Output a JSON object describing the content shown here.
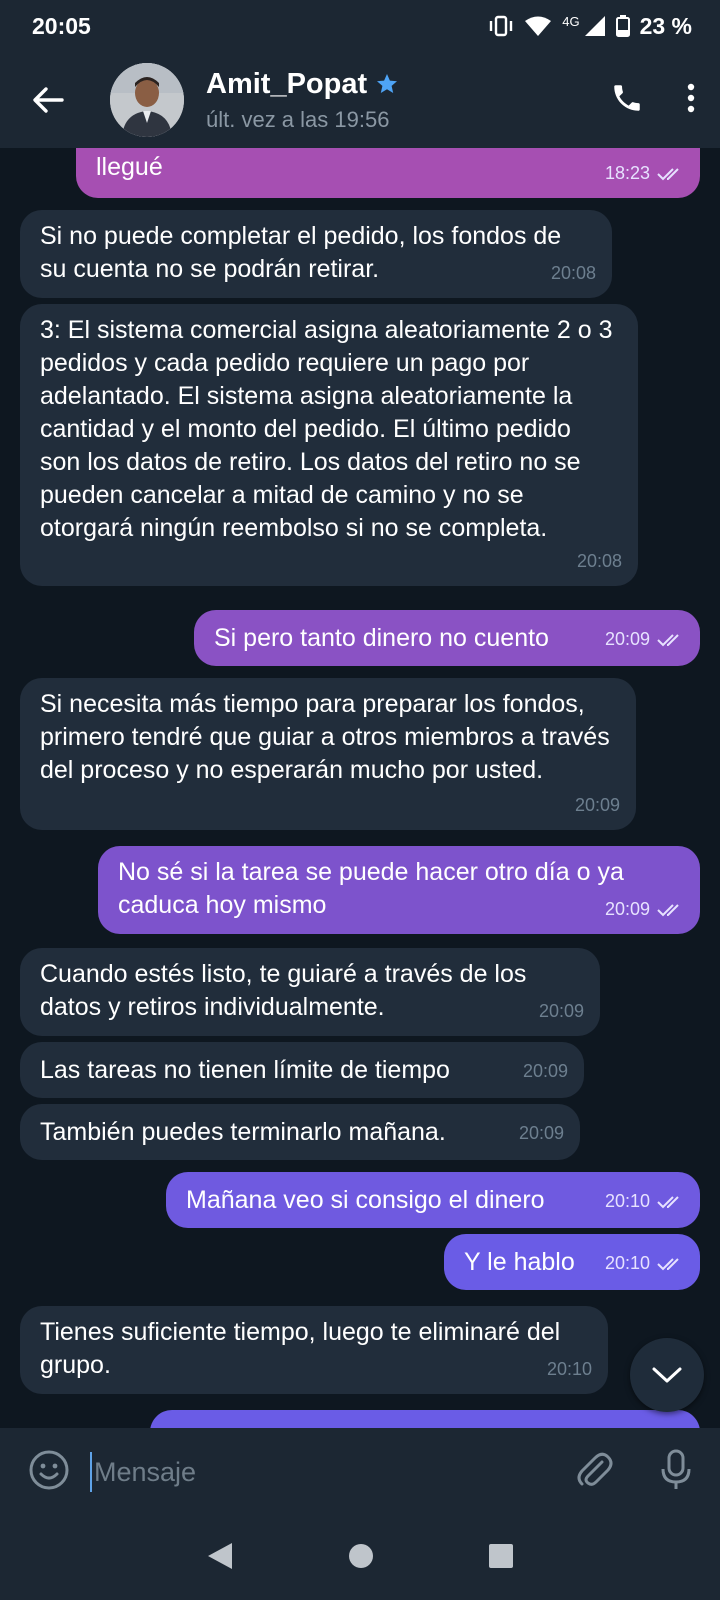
{
  "status_bar": {
    "time": "20:05",
    "network": "4G",
    "battery": "23 %"
  },
  "header": {
    "contact_name": "Amit_Popat",
    "contact_status": "últ. vez a las 19:56"
  },
  "messages": [
    {
      "dir": "out",
      "text": "Bien dios en el grupo era de roceso y hasta ahí llegué",
      "time": "18:23",
      "checks": true
    },
    {
      "dir": "in",
      "text": "Si no puede completar el pedido, los fondos de su cuenta no se podrán retirar.",
      "time": "20:08"
    },
    {
      "dir": "in",
      "text": "3: El sistema comercial asigna aleatoriamente 2 o 3 pedidos y cada pedido requiere un pago por adelantado. El sistema asigna aleatoriamente la cantidad y el monto del pedido. El último pedido son los datos de retiro. Los datos del retiro no se pueden cancelar a mitad de camino y no se otorgará ningún reembolso si no se completa.",
      "time": "20:08"
    },
    {
      "dir": "out",
      "text": "Si pero tanto dinero no cuento",
      "time": "20:09",
      "checks": true
    },
    {
      "dir": "in",
      "text": "Si necesita más tiempo para preparar los fondos, primero tendré que guiar a otros miembros a través del proceso y no esperarán mucho por usted.",
      "time": "20:09"
    },
    {
      "dir": "out",
      "text": "No sé si la tarea se puede hacer otro día o ya caduca hoy mismo",
      "time": "20:09",
      "checks": true
    },
    {
      "dir": "in",
      "text": "Cuando estés listo, te guiaré a través de los datos y retiros individualmente.",
      "time": "20:09"
    },
    {
      "dir": "in",
      "text": "Las tareas no tienen límite de tiempo",
      "time": "20:09"
    },
    {
      "dir": "in",
      "text": "También puedes terminarlo mañana.",
      "time": "20:09"
    },
    {
      "dir": "out",
      "text": "Mañana veo si consigo el dinero",
      "time": "20:10",
      "checks": true
    },
    {
      "dir": "out",
      "text": "Y le hablo",
      "time": "20:10",
      "checks": true
    },
    {
      "dir": "in",
      "text": "Tienes suficiente tiempo, luego te eliminaré del grupo.",
      "time": "20:10"
    }
  ],
  "input": {
    "placeholder": "Mensaje"
  },
  "colors": {
    "header_bg": "#1c2733",
    "chat_bg": "#0e1720",
    "incoming_bubble": "#212d3b",
    "outgoing_top": "#a84fb3",
    "outgoing_bottom": "#6a5ce6",
    "verified_star": "#4ea4f6",
    "caret": "#5fa3e8"
  },
  "icons": {
    "back": "arrow-left-icon",
    "verified": "star-icon",
    "call": "phone-icon",
    "menu": "more-vertical-icon",
    "emoji": "smiley-icon",
    "attach": "paperclip-icon",
    "voice": "microphone-icon",
    "scroll": "chevron-down-icon",
    "nav_back": "triangle-back-icon",
    "nav_home": "circle-home-icon",
    "nav_recents": "square-recents-icon"
  }
}
